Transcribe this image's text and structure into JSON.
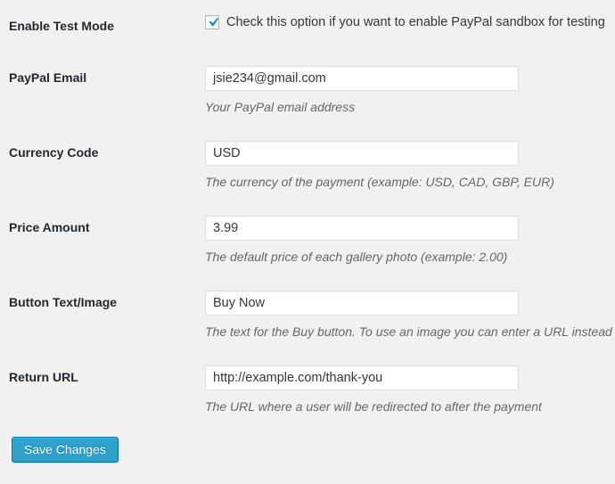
{
  "form": {
    "rows": [
      {
        "id": "enable-test-mode",
        "type": "checkbox",
        "label": "Enable Test Mode",
        "checkbox_label": "Check this option if you want to enable PayPal sandbox for testing",
        "checked": true,
        "description": ""
      },
      {
        "id": "paypal-email",
        "type": "text",
        "label": "PayPal Email",
        "value": "jsie234@gmail.com",
        "placeholder": "",
        "description": "Your PayPal email address"
      },
      {
        "id": "currency-code",
        "type": "text",
        "label": "Currency Code",
        "value": "USD",
        "placeholder": "",
        "description": "The currency of the payment (example: USD, CAD, GBP, EUR)"
      },
      {
        "id": "price-amount",
        "type": "text",
        "label": "Price Amount",
        "value": "3.99",
        "placeholder": "",
        "description": "The default price of each gallery photo (example: 2.00)"
      },
      {
        "id": "button-text-image",
        "type": "text",
        "label": "Button Text/Image",
        "value": "Buy Now",
        "placeholder": "",
        "description": "The text for the Buy button. To use an image you can enter a URL instead"
      },
      {
        "id": "return-url",
        "type": "text",
        "label": "Return URL",
        "value": "http://example.com/thank-you",
        "placeholder": "",
        "description": "The URL where a user will be redirected to after the payment"
      }
    ],
    "submit": {
      "label": "Save Changes"
    },
    "icons": {
      "checkmark": "check-icon"
    },
    "colors": {
      "page_background": "#f1f1f1",
      "label_text": "#23282d",
      "description_text": "#666666",
      "input_border": "#dddddd",
      "input_background": "#ffffff",
      "checkbox_border": "#b4b9be",
      "checkbox_check": "#1e8cbe",
      "button_background": "#2ea2cc",
      "button_border": "#0074a2",
      "button_text": "#ffffff"
    }
  }
}
